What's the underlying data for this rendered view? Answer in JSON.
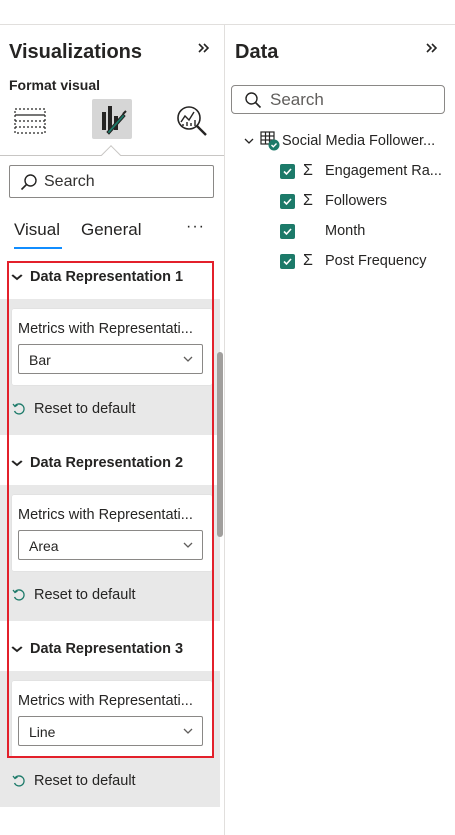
{
  "left_pane": {
    "title": "Visualizations",
    "expand_icon": "double-chevron-right",
    "subtitle": "Format visual",
    "icons": [
      "build-visual-icon",
      "format-visual-icon",
      "analytics-icon"
    ],
    "search_placeholder": "Search",
    "tabs": [
      {
        "label": "Visual",
        "selected": true
      },
      {
        "label": "General",
        "selected": false
      }
    ],
    "more_label": "···",
    "sections": [
      {
        "title": "Data Representation 1",
        "field_label": "Metrics with Representati...",
        "dropdown_value": "Bar",
        "reset_label": "Reset to default"
      },
      {
        "title": "Data Representation 2",
        "field_label": "Metrics with Representati...",
        "dropdown_value": "Area",
        "reset_label": "Reset to default"
      },
      {
        "title": "Data Representation 3",
        "field_label": "Metrics with Representati...",
        "dropdown_value": "Line",
        "reset_label": "Reset to default"
      }
    ]
  },
  "right_pane": {
    "title": "Data",
    "expand_icon": "double-chevron-right",
    "search_placeholder": "Search",
    "table_name": "Social Media Follower...",
    "fields": [
      {
        "name": "Engagement Ra...",
        "checked": true,
        "measure": true
      },
      {
        "name": "Followers",
        "checked": true,
        "measure": true
      },
      {
        "name": "Month",
        "checked": true,
        "measure": false
      },
      {
        "name": "Post Frequency",
        "checked": true,
        "measure": true
      }
    ]
  },
  "colors": {
    "accent": "#118dff",
    "checkbox": "#1c7a69",
    "highlight": "#e3202b",
    "section_background": "#e8e8e8"
  }
}
